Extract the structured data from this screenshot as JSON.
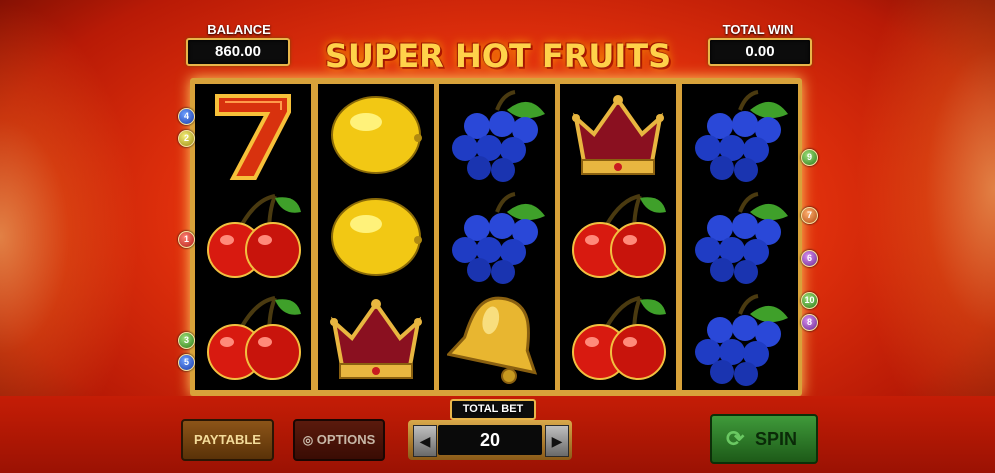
{
  "header": {
    "balance_label": "BALANCE",
    "balance_value": "860.00",
    "total_win_label": "TOTAL WIN",
    "total_win_value": "0.00",
    "logo_text": "SUPER HOT FRUITS"
  },
  "reels": [
    [
      "seven-symbol",
      "cherries-symbol",
      "cherries-symbol"
    ],
    [
      "lemon-symbol",
      "lemon-symbol",
      "crown-symbol"
    ],
    [
      "grapes-symbol",
      "grapes-symbol",
      "bell-symbol"
    ],
    [
      "crown-symbol",
      "cherries-symbol",
      "cherries-symbol"
    ],
    [
      "grapes-symbol",
      "grapes-symbol",
      "grapes-symbol"
    ]
  ],
  "paylines_left": [
    {
      "number": "4",
      "color": "blue"
    },
    {
      "number": "2",
      "color": "yellow"
    },
    {
      "number": "1",
      "color": "red"
    },
    {
      "number": "3",
      "color": "green"
    },
    {
      "number": "5",
      "color": "blue"
    }
  ],
  "paylines_right": [
    {
      "number": "9",
      "color": "green"
    },
    {
      "number": "7",
      "color": "orange"
    },
    {
      "number": "6",
      "color": "purple"
    },
    {
      "number": "10",
      "color": "green"
    },
    {
      "number": "8",
      "color": "purple"
    }
  ],
  "controls": {
    "paytable_label": "PAYTABLE",
    "options_label": "OPTIONS",
    "total_bet_label": "TOTAL BET",
    "total_bet_value": "20",
    "decrease_icon": "arrow-left-icon",
    "increase_icon": "arrow-right-icon",
    "spin_label": "SPIN",
    "spin_icon": "refresh-icon"
  },
  "colors": {
    "background": "#e0300c",
    "gold": "#e8b64a",
    "spin_green": "#3f9a3a"
  }
}
